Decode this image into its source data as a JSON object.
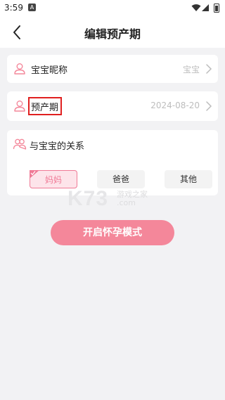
{
  "status_bar": {
    "time": "3:59",
    "notification_icon": "A"
  },
  "header": {
    "title": "编辑预产期",
    "back_icon": "chevron-left-icon"
  },
  "rows": {
    "nickname": {
      "label": "宝宝昵称",
      "value": "宝宝",
      "icon": "person-icon"
    },
    "due_date": {
      "label": "预产期",
      "value": "2024-08-20",
      "icon": "person-icon"
    }
  },
  "relationship": {
    "label": "与宝宝的关系",
    "icon": "group-icon",
    "options": [
      "妈妈",
      "爸爸",
      "其他"
    ],
    "selected": "妈妈"
  },
  "watermark": {
    "brand": "K73",
    "sub": "游戏之家",
    "domain": ".com"
  },
  "action": {
    "label": "开启怀孕模式"
  },
  "colors": {
    "accent": "#f4879a",
    "selected_border": "#f07a96",
    "highlight_box": "#e02020"
  }
}
